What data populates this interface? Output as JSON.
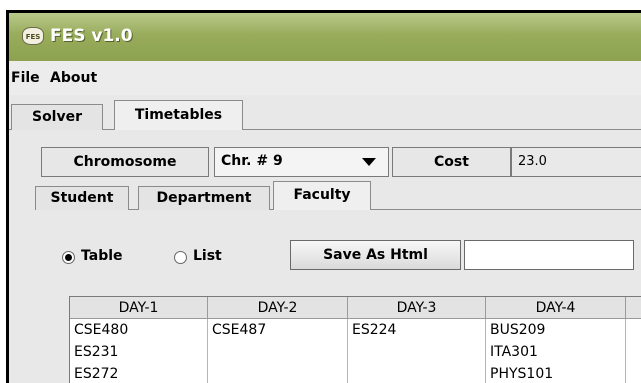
{
  "window": {
    "app_icon_text": "FES",
    "title": "FES v1.0"
  },
  "menubar": {
    "items": [
      "File",
      "About"
    ]
  },
  "main_tabs": [
    "Solver",
    "Timetables"
  ],
  "toolbar": {
    "chromosome_label": "Chromosome",
    "chromosome_selected": "Chr. # 9",
    "cost_label": "Cost",
    "cost_value": "23.0"
  },
  "view_tabs": [
    "Student",
    "Department",
    "Faculty"
  ],
  "view_options": {
    "table_label": "Table",
    "list_label": "List",
    "selected": "Table",
    "save_button": "Save As Html",
    "save_field_value": ""
  },
  "table": {
    "headers": [
      "DAY-1",
      "DAY-2",
      "DAY-3",
      "DAY-4"
    ],
    "columns": [
      [
        "CSE480",
        "ES231",
        "ES272"
      ],
      [
        "CSE487"
      ],
      [
        "ES224"
      ],
      [
        "BUS209",
        "ITA301",
        "PHYS101"
      ]
    ]
  }
}
